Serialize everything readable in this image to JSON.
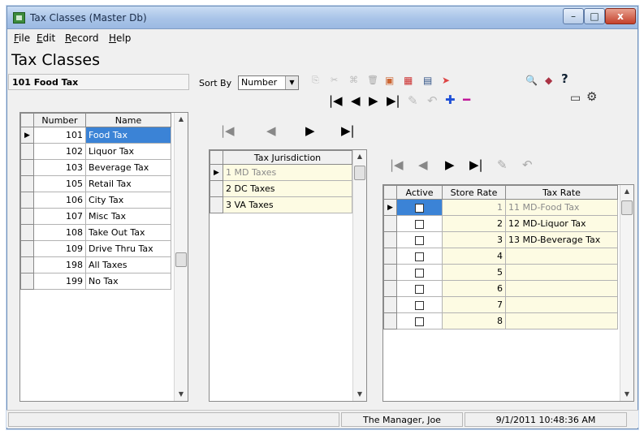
{
  "window": {
    "title": "Tax Classes (Master Db)",
    "min": "–",
    "max": "□",
    "close": "x"
  },
  "menu": [
    {
      "label": "File",
      "u": "F",
      "rest": "ile"
    },
    {
      "label": "Edit",
      "u": "E",
      "rest": "dit"
    },
    {
      "label": "Record",
      "u": "R",
      "rest": "ecord"
    },
    {
      "label": "Help",
      "u": "H",
      "rest": "elp"
    }
  ],
  "header": {
    "title": "Tax Classes",
    "current": "101 Food Tax"
  },
  "sort": {
    "label": "Sort By",
    "value": "Number"
  },
  "icons": {
    "first": "|◀",
    "prev": "◀",
    "next": "▶",
    "last": "▶|",
    "edit": "✎",
    "undo": "↶",
    "add": "✚",
    "remove": "━",
    "find": "🔍",
    "help": "?"
  },
  "left_grid": {
    "columns": [
      "Number",
      "Name"
    ],
    "rows": [
      {
        "number": "101",
        "name": "Food Tax"
      },
      {
        "number": "102",
        "name": "Liquor Tax"
      },
      {
        "number": "103",
        "name": "Beverage Tax"
      },
      {
        "number": "105",
        "name": "Retail Tax"
      },
      {
        "number": "106",
        "name": "City Tax"
      },
      {
        "number": "107",
        "name": "Misc Tax"
      },
      {
        "number": "108",
        "name": "Take Out Tax"
      },
      {
        "number": "109",
        "name": "Drive Thru Tax"
      },
      {
        "number": "198",
        "name": "All Taxes"
      },
      {
        "number": "199",
        "name": "No Tax"
      }
    ]
  },
  "jurisdiction_grid": {
    "columns": [
      "Tax Jurisdiction"
    ],
    "rows": [
      "1  MD Taxes",
      "2  DC Taxes",
      "3  VA Taxes"
    ]
  },
  "rates_grid": {
    "columns": [
      "Active",
      "Store Rate",
      "Tax Rate"
    ],
    "rows": [
      {
        "active": true,
        "store": "1",
        "rate": "11  MD-Food Tax"
      },
      {
        "active": false,
        "store": "2",
        "rate": "12  MD-Liquor Tax"
      },
      {
        "active": false,
        "store": "3",
        "rate": "13  MD-Beverage Tax"
      },
      {
        "active": false,
        "store": "4",
        "rate": ""
      },
      {
        "active": false,
        "store": "5",
        "rate": ""
      },
      {
        "active": false,
        "store": "6",
        "rate": ""
      },
      {
        "active": false,
        "store": "7",
        "rate": ""
      },
      {
        "active": false,
        "store": "8",
        "rate": ""
      }
    ]
  },
  "status": {
    "user": "The Manager, Joe",
    "datetime": "9/1/2011 10:48:36 AM"
  },
  "colors": {
    "selection": "#3b83d6",
    "row_yellow": "#fdfbe3",
    "add": "#1e4fd6",
    "remove": "#c0179a"
  }
}
